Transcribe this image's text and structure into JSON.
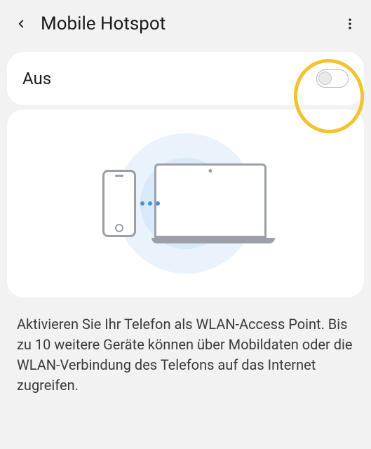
{
  "header": {
    "title": "Mobile Hotspot"
  },
  "hotspot": {
    "state_label": "Aus",
    "enabled": false
  },
  "description": "Aktivieren Sie Ihr Telefon als WLAN-Access Point. Bis zu 10 weitere Geräte können über Mobildaten oder die WLAN-Verbindung des Telefons auf das Internet zugreifen."
}
